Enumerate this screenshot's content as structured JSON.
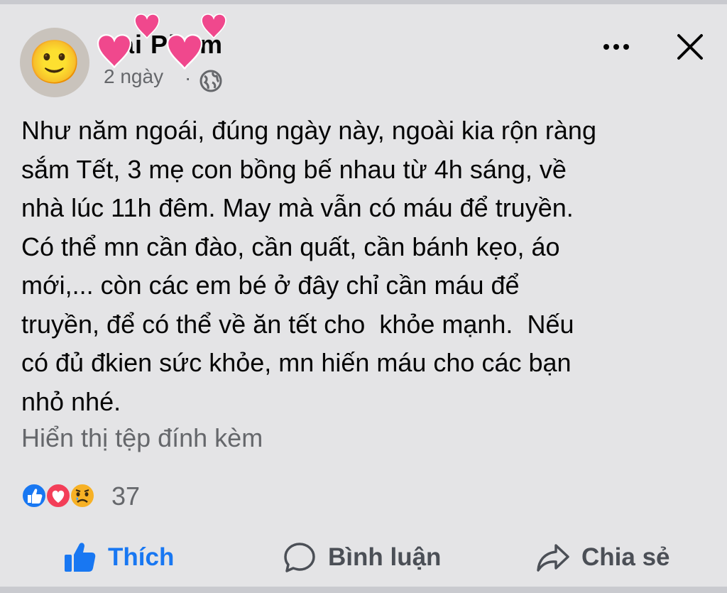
{
  "post": {
    "author": "Lai Pham",
    "time": "2 ngày",
    "separator": "·",
    "privacy_icon": "globe-icon",
    "avatar_emoji": "🙂",
    "text": "Như năm ngoái, đúng ngày này, ngoài kia rộn ràng\nsắm Tết, 3 mẹ con bồng bế nhau từ 4h sáng, về\nnhà lúc 11h đêm. May mà vẫn có máu để truyền.\nCó thể mn cần đào, cần quất, cần bánh kẹo, áo\nmới,... còn các em bé ở đây chỉ cần máu để\ntruyền, để có thể về ăn tết cho  khỏe mạnh.  Nếu\ncó đủ đkien sức khỏe, mn hiến máu cho các bạn\nnhỏ nhé.",
    "attachment_link": "Hiển thị tệp đính kèm"
  },
  "header": {
    "more_icon": "more-icon",
    "close_icon": "close-icon"
  },
  "reactions": {
    "icons": [
      "like-reaction-icon",
      "love-reaction-icon",
      "sad-reaction-icon"
    ],
    "count": "37"
  },
  "actions": {
    "like_label": "Thích",
    "comment_label": "Bình luận",
    "share_label": "Chia sẻ"
  },
  "colors": {
    "background": "#e4e4e6",
    "text": "#050505",
    "secondary_text": "#65676b",
    "accent_blue": "#1877f2",
    "love_red": "#f33e58",
    "sad_yellow": "#f7b125",
    "sticker_pink": "#f0488d"
  }
}
